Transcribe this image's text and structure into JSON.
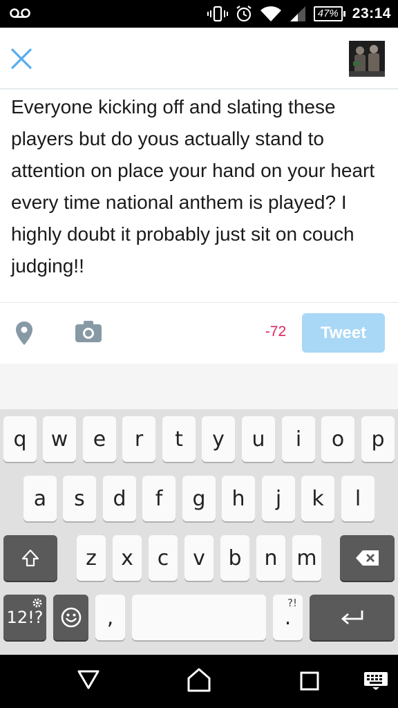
{
  "status_bar": {
    "voicemail_icon": "voicemail-icon",
    "icons": [
      "vibrate-icon",
      "alarm-icon",
      "wifi-icon",
      "cell-signal-icon"
    ],
    "battery": "47%",
    "time": "23:14"
  },
  "header": {
    "close_icon": "close-icon",
    "avatar": "profile-avatar"
  },
  "compose": {
    "text": "Everyone kicking off and slating these players but do yous actually stand to attention on place your hand on your heart every time national anthem is played? I highly doubt it probably just sit on couch judging!!"
  },
  "toolbar": {
    "location_icon": "location-pin-icon",
    "camera_icon": "camera-icon",
    "char_count": "-72",
    "tweet_label": "Tweet"
  },
  "keyboard": {
    "row1": [
      "q",
      "w",
      "e",
      "r",
      "t",
      "y",
      "u",
      "i",
      "o",
      "p"
    ],
    "row2": [
      "a",
      "s",
      "d",
      "f",
      "g",
      "h",
      "j",
      "k",
      "l"
    ],
    "row3": [
      "z",
      "x",
      "c",
      "v",
      "b",
      "n",
      "m"
    ],
    "symbols_label": "12!?",
    "comma_label": ",",
    "period_label": ".",
    "period_hint": "?!"
  },
  "nav_bar": {
    "buttons": [
      "back-icon",
      "home-icon",
      "recents-icon",
      "keyboard-switch-icon"
    ]
  },
  "colors": {
    "accent_blue": "#55acee",
    "tweet_button_disabled": "#a9d7f6",
    "counter_negative": "#e0245e",
    "icon_grey": "#8899a6"
  }
}
